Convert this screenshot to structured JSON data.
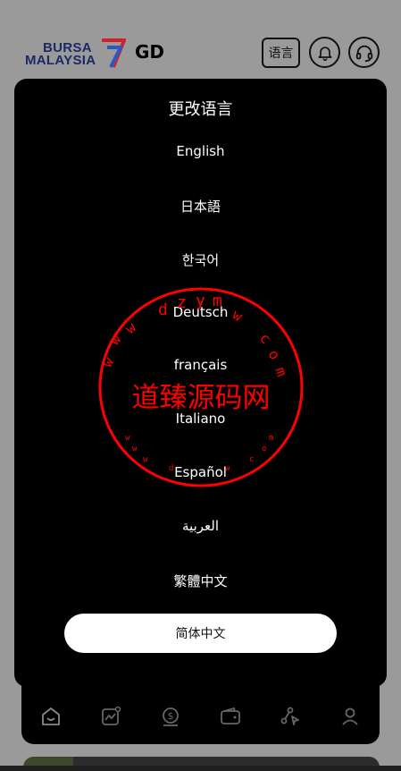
{
  "header": {
    "logo_line1": "BURSA",
    "logo_line2": "MALAYSIA",
    "ticker": "GD",
    "language_button": "语言"
  },
  "modal": {
    "title": "更改语言",
    "options": [
      "English",
      "日本語",
      "한국어",
      "Deutsch",
      "français",
      "Italiano",
      "Español",
      "العربية",
      "繁體中文"
    ],
    "selected": "简体中文"
  },
  "watermark": {
    "main_text": "道臻源码网",
    "url_text": "www.dzym.com"
  },
  "icons": {
    "bell": "bell-icon",
    "support": "headset-icon",
    "nav": [
      "home-icon",
      "chart-icon",
      "dollar-icon",
      "wallet-icon",
      "share-icon",
      "user-icon"
    ]
  },
  "colors": {
    "brand_navy": "#1b2a66",
    "brand_red": "#d42027",
    "brand_blue": "#2b59c3",
    "stamp_red": "#ff0000"
  }
}
